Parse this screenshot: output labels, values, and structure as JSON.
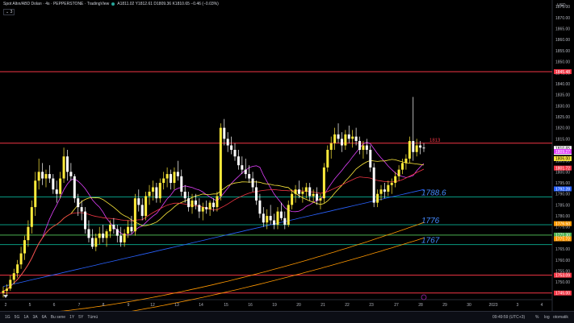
{
  "header": {
    "title": "Spot Altın/ABD Doları · 4s · PEPPERSTONE · TradingView",
    "ohlc": "A1811.02 Y1812.61 D1809.36 K1810.65 −0.46 (−0.03%)",
    "indicator_count": "3"
  },
  "colors": {
    "background": "#000000",
    "up_candle": "#ffeb3b",
    "down_candle": "#ffffff",
    "red_line": "#f23645",
    "teal_line": "#089981",
    "green_line": "#4caf50",
    "blue_ma": "#2962ff",
    "orange_ma": "#ff9800"
  },
  "axis": {
    "currency": "USD",
    "ticks": [
      "1875.00",
      "1870.00",
      "1865.00",
      "1860.00",
      "1855.00",
      "1850.00",
      "1845.00",
      "1840.00",
      "1835.00",
      "1830.00",
      "1825.00",
      "1820.00",
      "1815.00",
      "1810.00",
      "1805.00",
      "1800.00",
      "1795.00",
      "1790.00",
      "1785.00",
      "1780.00",
      "1775.00",
      "1770.00",
      "1765.00",
      "1760.00",
      "1755.00",
      "1750.00",
      "1745.00"
    ],
    "price_tags": [
      {
        "text": "1845.48",
        "value": 1845.48,
        "color": "#f23645"
      },
      {
        "text": "1810.65",
        "value": 1810.65,
        "color": "#ffffff",
        "sub": "01:25:27"
      },
      {
        "text": "1809.27",
        "value": 1809.27,
        "color": "#e040fb"
      },
      {
        "text": "1806.00",
        "value": 1806.0,
        "color": "#ffeb3b"
      },
      {
        "text": "1801.72",
        "value": 1801.72,
        "color": "#f23645"
      },
      {
        "text": "1792.28",
        "value": 1792.28,
        "color": "#2962ff"
      },
      {
        "text": "1776.50",
        "value": 1776.5,
        "color": "#ff9800"
      },
      {
        "text": "1771.30",
        "value": 1771.3,
        "color": "#4caf50"
      },
      {
        "text": "1771.72",
        "value": 1769.6,
        "color": "#ff9800"
      },
      {
        "text": "1753.09",
        "value": 1753.09,
        "color": "#f23645"
      },
      {
        "text": "1745.00",
        "value": 1745.0,
        "color": "#f23645"
      }
    ]
  },
  "xaxis": {
    "labels": [
      "2",
      "5",
      "6",
      "7",
      "8",
      "9",
      "12",
      "13",
      "14",
      "15",
      "16",
      "19",
      "20",
      "21",
      "22",
      "23",
      "27",
      "28",
      "29",
      "30",
      "2023",
      "3",
      "4"
    ],
    "highlight": "28"
  },
  "bottom_bar": {
    "ranges": [
      "1G",
      "5G",
      "1A",
      "3A",
      "6A",
      "Bu sene",
      "1Y",
      "5Y",
      "Tümü"
    ],
    "time": "09:49:59 (UTC+3)",
    "percent": "%",
    "log": "log",
    "auto": "otomatik"
  },
  "chart_data": {
    "type": "candlestick",
    "y_range": [
      1742,
      1878
    ],
    "hlines": [
      {
        "value": 1845.48,
        "color": "#f23645"
      },
      {
        "value": 1813.0,
        "color": "#f23645",
        "label": "1813"
      },
      {
        "value": 1788.6,
        "color": "#089981",
        "label": "1788.6"
      },
      {
        "value": 1776.0,
        "color": "#089981",
        "label": "1776"
      },
      {
        "value": 1771.3,
        "color": "#4caf50"
      },
      {
        "value": 1767.0,
        "color": "#089981",
        "label": "1767"
      },
      {
        "value": 1753.09,
        "color": "#f23645"
      },
      {
        "value": 1745.0,
        "color": "#f23645"
      }
    ],
    "candles": [
      [
        1745,
        1748,
        1743,
        1746
      ],
      [
        1746,
        1749,
        1744,
        1747
      ],
      [
        1747,
        1753,
        1746,
        1751
      ],
      [
        1751,
        1756,
        1749,
        1754
      ],
      [
        1754,
        1760,
        1752,
        1758
      ],
      [
        1758,
        1766,
        1756,
        1763
      ],
      [
        1763,
        1771,
        1760,
        1769
      ],
      [
        1769,
        1778,
        1766,
        1775
      ],
      [
        1775,
        1787,
        1772,
        1784
      ],
      [
        1784,
        1800,
        1780,
        1796
      ],
      [
        1796,
        1806,
        1792,
        1800
      ],
      [
        1800,
        1804,
        1794,
        1797
      ],
      [
        1797,
        1801,
        1793,
        1799
      ],
      [
        1799,
        1803,
        1795,
        1797
      ],
      [
        1797,
        1799,
        1790,
        1792
      ],
      [
        1792,
        1796,
        1786,
        1790
      ],
      [
        1790,
        1800,
        1788,
        1797
      ],
      [
        1797,
        1811,
        1795,
        1807
      ],
      [
        1807,
        1810,
        1796,
        1800
      ],
      [
        1800,
        1804,
        1796,
        1798
      ],
      [
        1798,
        1799,
        1786,
        1788
      ],
      [
        1788,
        1790,
        1780,
        1784
      ],
      [
        1784,
        1787,
        1778,
        1782
      ],
      [
        1782,
        1784,
        1772,
        1774
      ],
      [
        1774,
        1778,
        1768,
        1770
      ],
      [
        1770,
        1774,
        1765,
        1766
      ],
      [
        1766,
        1772,
        1764,
        1770
      ],
      [
        1770,
        1775,
        1767,
        1772
      ],
      [
        1772,
        1776,
        1768,
        1770
      ],
      [
        1770,
        1774,
        1766,
        1773
      ],
      [
        1773,
        1778,
        1770,
        1776
      ],
      [
        1776,
        1779,
        1772,
        1774
      ],
      [
        1774,
        1776,
        1768,
        1771
      ],
      [
        1771,
        1775,
        1766,
        1768
      ],
      [
        1768,
        1774,
        1766,
        1772
      ],
      [
        1772,
        1778,
        1770,
        1775
      ],
      [
        1775,
        1780,
        1772,
        1773
      ],
      [
        1773,
        1790,
        1771,
        1788
      ],
      [
        1788,
        1792,
        1782,
        1785
      ],
      [
        1785,
        1788,
        1778,
        1780
      ],
      [
        1780,
        1791,
        1778,
        1789
      ],
      [
        1789,
        1794,
        1785,
        1791
      ],
      [
        1791,
        1796,
        1787,
        1793
      ],
      [
        1793,
        1795,
        1786,
        1788
      ],
      [
        1788,
        1797,
        1786,
        1795
      ],
      [
        1795,
        1800,
        1792,
        1797
      ],
      [
        1797,
        1802,
        1793,
        1799
      ],
      [
        1799,
        1801,
        1792,
        1795
      ],
      [
        1795,
        1802,
        1792,
        1800
      ],
      [
        1800,
        1805,
        1796,
        1798
      ],
      [
        1798,
        1801,
        1789,
        1791
      ],
      [
        1791,
        1794,
        1786,
        1788
      ],
      [
        1788,
        1791,
        1782,
        1784
      ],
      [
        1784,
        1790,
        1781,
        1787
      ],
      [
        1787,
        1790,
        1783,
        1785
      ],
      [
        1785,
        1788,
        1779,
        1782
      ],
      [
        1782,
        1786,
        1778,
        1784
      ],
      [
        1784,
        1787,
        1781,
        1783
      ],
      [
        1783,
        1787,
        1780,
        1786
      ],
      [
        1786,
        1788,
        1782,
        1784
      ],
      [
        1784,
        1791,
        1782,
        1789
      ],
      [
        1789,
        1822,
        1787,
        1820
      ],
      [
        1820,
        1824,
        1812,
        1815
      ],
      [
        1815,
        1818,
        1809,
        1812
      ],
      [
        1812,
        1816,
        1808,
        1810
      ],
      [
        1810,
        1813,
        1805,
        1807
      ],
      [
        1807,
        1810,
        1801,
        1803
      ],
      [
        1803,
        1807,
        1799,
        1801
      ],
      [
        1801,
        1806,
        1797,
        1799
      ],
      [
        1799,
        1803,
        1795,
        1797
      ],
      [
        1797,
        1800,
        1791,
        1793
      ],
      [
        1793,
        1796,
        1785,
        1787
      ],
      [
        1787,
        1790,
        1779,
        1781
      ],
      [
        1781,
        1784,
        1775,
        1777
      ],
      [
        1777,
        1783,
        1774,
        1780
      ],
      [
        1780,
        1785,
        1776,
        1778
      ],
      [
        1778,
        1781,
        1774,
        1776
      ],
      [
        1776,
        1784,
        1774,
        1782
      ],
      [
        1782,
        1786,
        1778,
        1779
      ],
      [
        1779,
        1782,
        1774,
        1776
      ],
      [
        1776,
        1787,
        1775,
        1785
      ],
      [
        1785,
        1792,
        1783,
        1790
      ],
      [
        1790,
        1794,
        1786,
        1792
      ],
      [
        1792,
        1796,
        1788,
        1790
      ],
      [
        1790,
        1793,
        1786,
        1791
      ],
      [
        1791,
        1795,
        1788,
        1793
      ],
      [
        1793,
        1795,
        1787,
        1789
      ],
      [
        1789,
        1792,
        1786,
        1790
      ],
      [
        1790,
        1793,
        1785,
        1787
      ],
      [
        1787,
        1790,
        1783,
        1788
      ],
      [
        1788,
        1804,
        1786,
        1802
      ],
      [
        1802,
        1812,
        1800,
        1810
      ],
      [
        1810,
        1816,
        1806,
        1813
      ],
      [
        1813,
        1820,
        1810,
        1817
      ],
      [
        1817,
        1822,
        1813,
        1815
      ],
      [
        1815,
        1818,
        1809,
        1812
      ],
      [
        1812,
        1819,
        1810,
        1817
      ],
      [
        1817,
        1821,
        1813,
        1815
      ],
      [
        1815,
        1819,
        1811,
        1816
      ],
      [
        1816,
        1820,
        1812,
        1814
      ],
      [
        1814,
        1816,
        1808,
        1810
      ],
      [
        1810,
        1814,
        1806,
        1812
      ],
      [
        1812,
        1815,
        1808,
        1810
      ],
      [
        1810,
        1812,
        1800,
        1802
      ],
      [
        1802,
        1804,
        1784,
        1786
      ],
      [
        1786,
        1792,
        1784,
        1790
      ],
      [
        1790,
        1794,
        1787,
        1792
      ],
      [
        1792,
        1795,
        1788,
        1791
      ],
      [
        1791,
        1796,
        1789,
        1794
      ],
      [
        1794,
        1797,
        1790,
        1795
      ],
      [
        1795,
        1800,
        1793,
        1798
      ],
      [
        1798,
        1803,
        1796,
        1801
      ],
      [
        1801,
        1806,
        1799,
        1804
      ],
      [
        1804,
        1808,
        1801,
        1806
      ],
      [
        1806,
        1816,
        1804,
        1814
      ],
      [
        1814,
        1834,
        1805,
        1809
      ],
      [
        1809,
        1815,
        1807,
        1812
      ],
      [
        1812,
        1814,
        1808,
        1811
      ],
      [
        1811,
        1813,
        1809,
        1810.65
      ]
    ]
  }
}
